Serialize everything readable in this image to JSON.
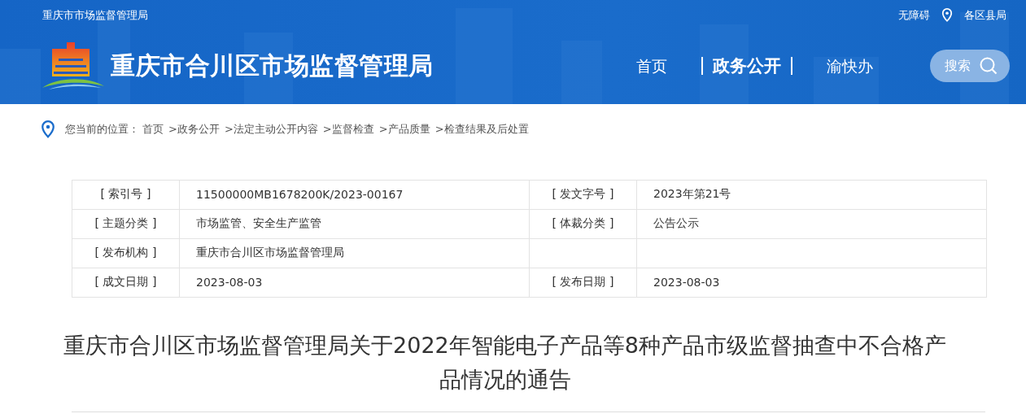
{
  "top_bar": {
    "site_link": "重庆市市场监督管理局",
    "accessibility": "无障碍",
    "districts": "各区县局"
  },
  "header": {
    "title": "重庆市合川区市场监督管理局",
    "nav": [
      {
        "label": "首页",
        "selected": false
      },
      {
        "label": "政务公开",
        "selected": true
      },
      {
        "label": "渝快办",
        "selected": false
      }
    ],
    "search_button": "搜索"
  },
  "breadcrumb": {
    "label": "您当前的位置：",
    "items": [
      "首页",
      ">政务公开",
      ">法定主动公开内容",
      ">监督检查",
      ">产品质量",
      ">检查结果及后处置"
    ]
  },
  "info_table": {
    "rows": [
      {
        "cells": [
          "[ 索引号 ]",
          "11500000MB1678200K/2023-00167",
          "[ 发文字号 ]",
          "2023年第21号"
        ]
      },
      {
        "cells": [
          "[ 主题分类 ]",
          "市场监管、安全生产监管",
          "[ 体裁分类 ]",
          "公告公示"
        ]
      },
      {
        "cells": [
          "[ 发布机构 ]",
          "重庆市合川区市场监督管理局",
          "",
          ""
        ]
      },
      {
        "cells": [
          "[ 成文日期 ]",
          "2023-08-03",
          "[ 发布日期 ]",
          "2023-08-03"
        ]
      }
    ]
  },
  "article": {
    "title": "重庆市合川区市场监督管理局关于2022年智能电子产品等8种产品市级监督抽查中不合格产品情况的通告"
  }
}
